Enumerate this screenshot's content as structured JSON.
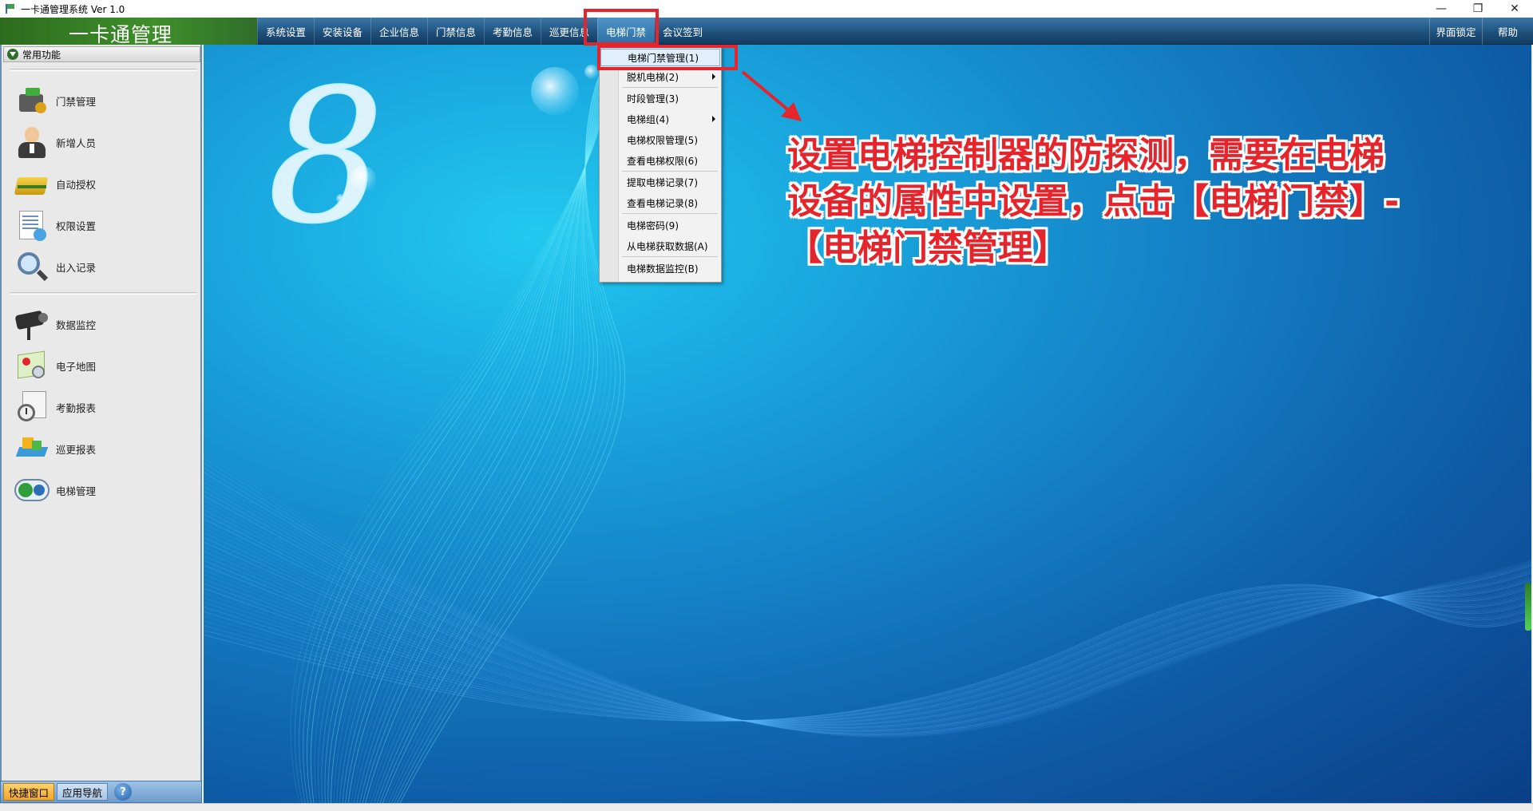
{
  "window": {
    "title": "一卡通管理系统  Ver 1.0",
    "controls": {
      "minimize": "—",
      "restore": "❐",
      "close": "✕"
    }
  },
  "header": {
    "logo": "一卡通管理",
    "menu": [
      "系统设置",
      "安装设备",
      "企业信息",
      "门禁信息",
      "考勤信息",
      "巡更信息",
      "电梯门禁",
      "会议签到"
    ],
    "active_menu": "电梯门禁",
    "right_buttons": [
      "界面锁定",
      "帮助"
    ]
  },
  "sidebar": {
    "header": "常用功能",
    "group1": [
      "门禁管理",
      "新增人员",
      "自动授权",
      "权限设置",
      "出入记录"
    ],
    "group2": [
      "数据监控",
      "电子地图",
      "考勤报表",
      "巡更报表",
      "电梯管理"
    ],
    "icons": [
      "access-control-icon",
      "person-icon",
      "card-icon",
      "permissions-icon",
      "magnifier-icon",
      "camera-icon",
      "map-icon",
      "clock-icon",
      "patrol-icon",
      "elevator-icon"
    ]
  },
  "bottom_tabs": {
    "quick": "快捷窗口",
    "nav": "应用导航",
    "help": "?"
  },
  "dropdown": {
    "items": [
      {
        "label": "电梯门禁管理(1)",
        "submenu": false
      },
      {
        "label": "脱机电梯(2)",
        "submenu": true
      },
      {
        "label": "时段管理(3)",
        "submenu": false
      },
      {
        "label": "电梯组(4)",
        "submenu": true
      },
      {
        "label": "电梯权限管理(5)",
        "submenu": false
      },
      {
        "label": "查看电梯权限(6)",
        "submenu": false
      },
      {
        "label": "提取电梯记录(7)",
        "submenu": false
      },
      {
        "label": "查看电梯记录(8)",
        "submenu": false
      },
      {
        "label": "电梯密码(9)",
        "submenu": false
      },
      {
        "label": "从电梯获取数据(A)",
        "submenu": false
      },
      {
        "label": "电梯数据监控(B)",
        "submenu": false
      }
    ]
  },
  "annotation": {
    "line1": "设置电梯控制器的防探测，需要在电梯",
    "line2": "设备的属性中设置，点击【电梯门禁】-",
    "line3": "【电梯门禁管理】"
  },
  "colors": {
    "highlight_red": "#e5242b",
    "menubar_blue": "#1d4e7a",
    "logo_green": "#3f8f2a"
  }
}
